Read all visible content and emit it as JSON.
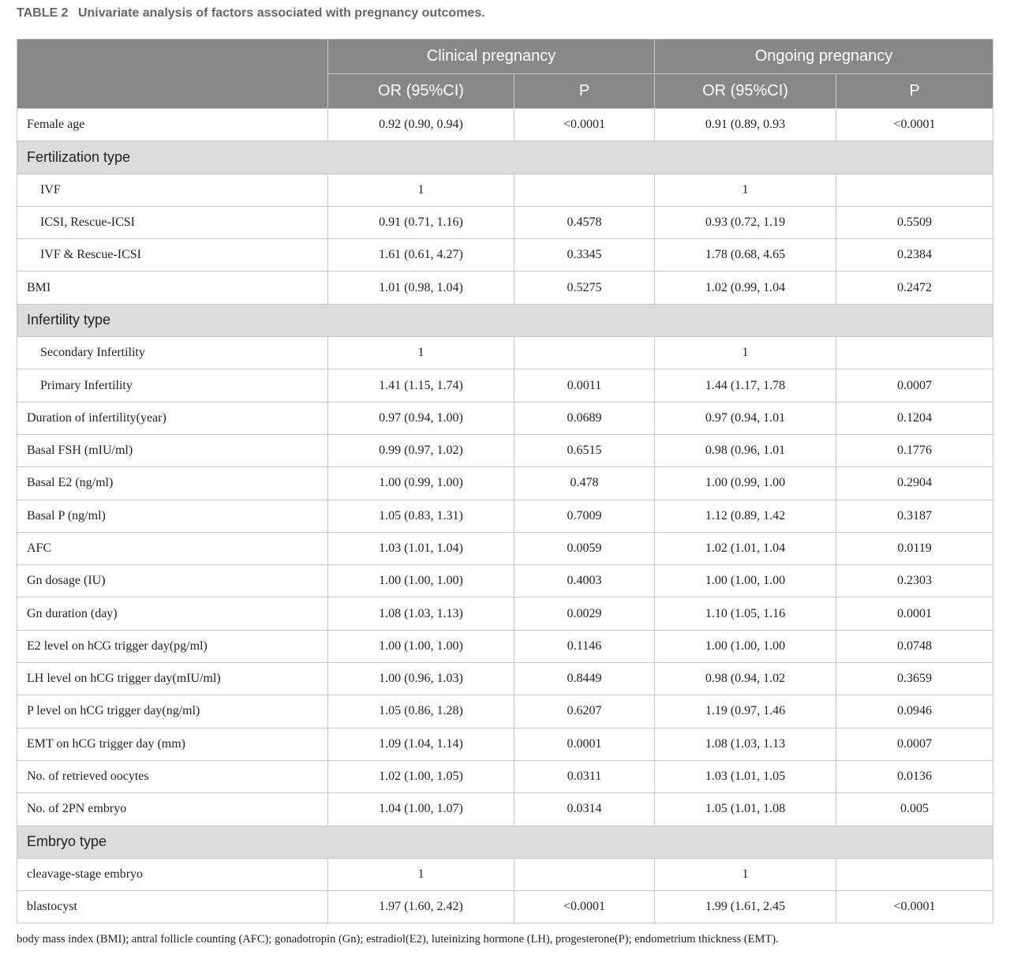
{
  "caption": {
    "table_number": "TABLE 2",
    "title": "Univariate analysis of factors associated with pregnancy outcomes."
  },
  "header": {
    "group1": "Clinical pregnancy",
    "group2": "Ongoing pregnancy",
    "or_label": "OR (95%CI)",
    "p_label": "P"
  },
  "rows": [
    {
      "type": "data",
      "label": "Female age",
      "indent": false,
      "cor": "0.92 (0.90, 0.94)",
      "cp": "<0.0001",
      "oor": "0.91 (0.89, 0.93",
      "op": "<0.0001"
    },
    {
      "type": "section",
      "label": "Fertilization type"
    },
    {
      "type": "data",
      "label": "IVF",
      "indent": true,
      "cor": "1",
      "cp": "",
      "oor": "1",
      "op": ""
    },
    {
      "type": "data",
      "label": "ICSI, Rescue-ICSI",
      "indent": true,
      "cor": "0.91 (0.71, 1.16)",
      "cp": "0.4578",
      "oor": "0.93 (0.72, 1.19",
      "op": "0.5509"
    },
    {
      "type": "data",
      "label": "IVF & Rescue-ICSI",
      "indent": true,
      "cor": "1.61 (0.61, 4.27)",
      "cp": "0.3345",
      "oor": "1.78 (0.68, 4.65",
      "op": "0.2384"
    },
    {
      "type": "data",
      "label": "BMI",
      "indent": false,
      "cor": "1.01 (0.98, 1.04)",
      "cp": "0.5275",
      "oor": "1.02 (0.99, 1.04",
      "op": "0.2472"
    },
    {
      "type": "section",
      "label": "Infertility type"
    },
    {
      "type": "data",
      "label": "Secondary Infertility",
      "indent": true,
      "cor": "1",
      "cp": "",
      "oor": "1",
      "op": ""
    },
    {
      "type": "data",
      "label": "Primary Infertility",
      "indent": true,
      "cor": "1.41 (1.15, 1.74)",
      "cp": "0.0011",
      "oor": "1.44 (1.17, 1.78",
      "op": "0.0007"
    },
    {
      "type": "data",
      "label": "Duration of infertility(year)",
      "indent": false,
      "cor": "0.97 (0.94, 1.00)",
      "cp": "0.0689",
      "oor": "0.97 (0.94, 1.01",
      "op": "0.1204"
    },
    {
      "type": "data",
      "label": "Basal FSH (mIU/ml)",
      "indent": false,
      "cor": "0.99 (0.97, 1.02)",
      "cp": "0.6515",
      "oor": "0.98 (0.96, 1.01",
      "op": "0.1776"
    },
    {
      "type": "data",
      "label": "Basal E2 (ng/ml)",
      "indent": false,
      "cor": "1.00 (0.99, 1.00)",
      "cp": "0.478",
      "oor": "1.00 (0.99, 1.00",
      "op": "0.2904"
    },
    {
      "type": "data",
      "label": "Basal P (ng/ml)",
      "indent": false,
      "cor": "1.05 (0.83, 1.31)",
      "cp": "0.7009",
      "oor": "1.12 (0.89, 1.42",
      "op": "0.3187"
    },
    {
      "type": "data",
      "label": "AFC",
      "indent": false,
      "cor": "1.03 (1.01, 1.04)",
      "cp": "0.0059",
      "oor": "1.02 (1.01, 1.04",
      "op": "0.0119"
    },
    {
      "type": "data",
      "label": "Gn dosage (IU)",
      "indent": false,
      "cor": "1.00 (1.00, 1.00)",
      "cp": "0.4003",
      "oor": "1.00 (1.00, 1.00",
      "op": "0.2303"
    },
    {
      "type": "data",
      "label": "Gn duration (day)",
      "indent": false,
      "cor": "1.08 (1.03, 1.13)",
      "cp": "0.0029",
      "oor": "1.10 (1.05, 1.16",
      "op": "0.0001"
    },
    {
      "type": "data",
      "label": "E2 level on hCG trigger day(pg/ml)",
      "indent": false,
      "cor": "1.00 (1.00, 1.00)",
      "cp": "0.1146",
      "oor": "1.00 (1.00, 1.00",
      "op": "0.0748"
    },
    {
      "type": "data",
      "label": "LH level on hCG trigger day(mIU/ml)",
      "indent": false,
      "cor": "1.00 (0.96, 1.03)",
      "cp": "0.8449",
      "oor": "0.98 (0.94, 1.02",
      "op": "0.3659"
    },
    {
      "type": "data",
      "label": "P level on hCG trigger day(ng/ml)",
      "indent": false,
      "cor": "1.05 (0.86, 1.28)",
      "cp": "0.6207",
      "oor": "1.19 (0.97, 1.46",
      "op": "0.0946"
    },
    {
      "type": "data",
      "label": "EMT on hCG trigger day (mm)",
      "indent": false,
      "cor": "1.09 (1.04, 1.14)",
      "cp": "0.0001",
      "oor": "1.08 (1.03, 1.13",
      "op": "0.0007"
    },
    {
      "type": "data",
      "label": "No. of retrieved oocytes",
      "indent": false,
      "cor": "1.02 (1.00, 1.05)",
      "cp": "0.0311",
      "oor": "1.03 (1.01, 1.05",
      "op": "0.0136"
    },
    {
      "type": "data",
      "label": "No. of 2PN embryo",
      "indent": false,
      "cor": "1.04 (1.00, 1.07)",
      "cp": "0.0314",
      "oor": "1.05 (1.01, 1.08",
      "op": "0.005"
    },
    {
      "type": "section",
      "label": "Embryo type"
    },
    {
      "type": "data",
      "label": "cleavage-stage embryo",
      "indent": false,
      "cor": "1",
      "cp": "",
      "oor": "1",
      "op": ""
    },
    {
      "type": "data",
      "label": "blastocyst",
      "indent": false,
      "cor": "1.97 (1.60, 2.42)",
      "cp": "<0.0001",
      "oor": "1.99 (1.61, 2.45",
      "op": "<0.0001"
    }
  ],
  "footnote": "body mass index (BMI); antral follicle counting (AFC); gonadotropin (Gn); estradiol(E2), luteinizing hormone (LH), progesterone(P); endometrium thickness (EMT)."
}
